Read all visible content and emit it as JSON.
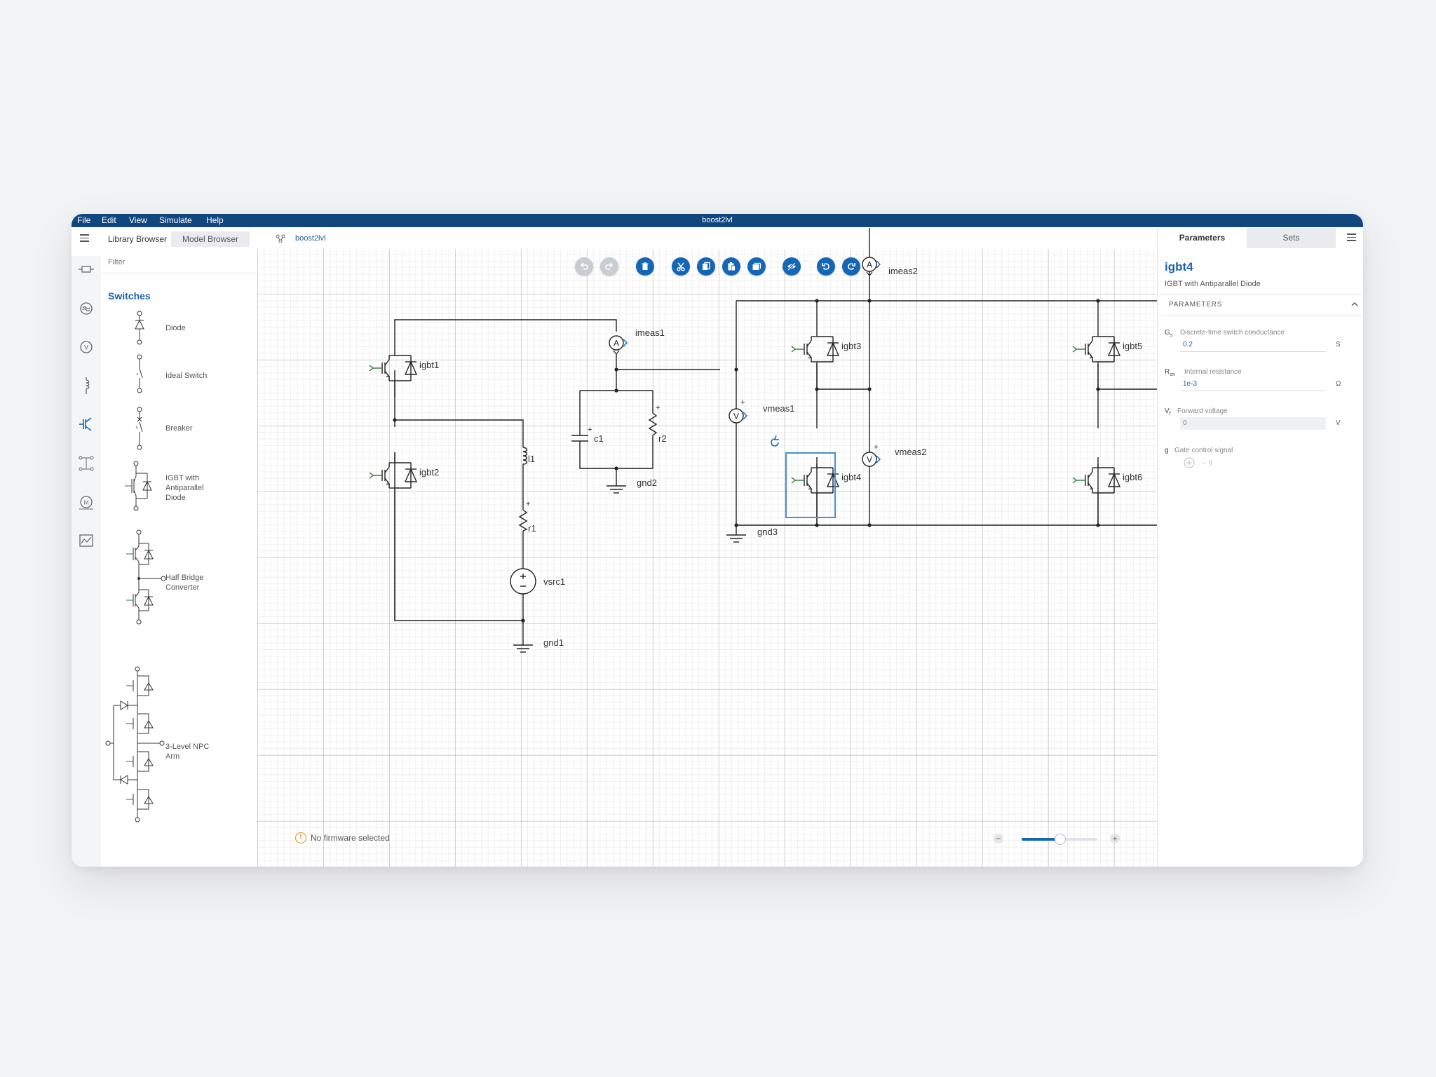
{
  "menubar": {
    "items": [
      "File",
      "Edit",
      "View",
      "Simulate",
      "Help"
    ],
    "title": "boost2lvl"
  },
  "library": {
    "tabs": [
      "Library Browser",
      "Model Browser"
    ],
    "filter_placeholder": "Filter",
    "category": "Switches",
    "items": [
      {
        "label": "Diode"
      },
      {
        "label": "Ideal Switch"
      },
      {
        "label": "Breaker"
      },
      {
        "label": "IGBT with Antiparallel Diode"
      },
      {
        "label": "Half Bridge Converter"
      },
      {
        "label": "3-Level NPC Arm"
      }
    ],
    "category_icons": [
      "passive-icon",
      "sources-icon",
      "voltmeter-icon",
      "inductor-icon",
      "switches-icon",
      "converters-icon",
      "machines-icon",
      "scope-icon"
    ]
  },
  "canvas": {
    "breadcrumb": "boost2lvl",
    "toolbar": [
      "undo",
      "redo",
      "delete",
      "cut",
      "copy",
      "paste",
      "duplicate",
      "hide",
      "rotate-left",
      "rotate-right"
    ],
    "labels": {
      "igbt1": "igbt1",
      "igbt2": "igbt2",
      "igbt3": "igbt3",
      "igbt4": "igbt4",
      "igbt5": "igbt5",
      "igbt6": "igbt6",
      "imeas1": "imeas1",
      "imeas2": "imeas2",
      "vmeas1": "vmeas1",
      "vmeas2": "vmeas2",
      "c1": "c1",
      "r2": "r2",
      "l1": "l1",
      "r1": "r1",
      "vsrc1": "vsrc1",
      "gnd1": "gnd1",
      "gnd2": "gnd2",
      "gnd3": "gnd3",
      "ammeter": "A",
      "voltmeter": "V",
      "plus": "+"
    },
    "status": "No firmware selected",
    "zoom_level": 0.5
  },
  "parameters": {
    "tabs": [
      "Parameters",
      "Sets"
    ],
    "component_name": "igbt4",
    "component_desc": "IGBT with Antiparallel Diode",
    "section": "PARAMETERS",
    "fields": [
      {
        "sym": "G",
        "sub": "s",
        "desc": "Discrete-time switch conductance",
        "value": "0.2",
        "unit": "S"
      },
      {
        "sym": "R",
        "sub": "on",
        "desc": "Internal resistance",
        "value": "1e-3",
        "unit": "Ω"
      },
      {
        "sym": "V",
        "sub": "f",
        "desc": "Forward voltage",
        "value": "0",
        "unit": "V"
      },
      {
        "sym": "g",
        "sub": "",
        "desc": "Gate control signal",
        "value": "→ g",
        "unit": ""
      }
    ]
  },
  "colors": {
    "brand": "#12467e",
    "accent": "#1567b5",
    "selection": "#4a8fd4",
    "warning": "#e0931c"
  }
}
